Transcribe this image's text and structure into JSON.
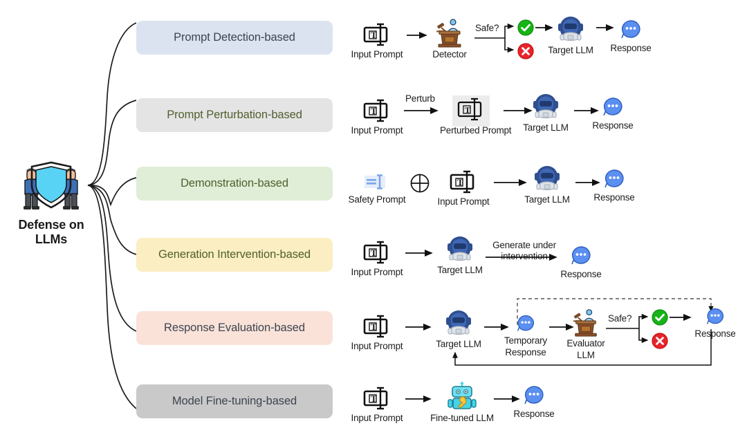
{
  "root": {
    "label_line1": "Defense on",
    "label_line2": "LLMs",
    "icon": "shield-with-guards-icon"
  },
  "palette": {
    "blue_box_bg": "#dce3f0",
    "blue_box_text": "#3d4450",
    "gray_box_bg": "#e4e4e4",
    "gray_box_text": "#4f5f2e",
    "green_box_bg": "#e0eed7",
    "green_box_text": "#4f5f2e",
    "yellow_box_bg": "#fbeec2",
    "yellow_box_text": "#4f5f2e",
    "peach_box_bg": "#fae2d8",
    "peach_box_text": "#3d4450",
    "darkgray_box_bg": "#c9c9c9",
    "darkgray_box_text": "#3d4450",
    "shield_cyan": "#58d2f5",
    "astronaut_navy": "#2f4f8f",
    "response_blue": "#5b8ff0",
    "check_green": "#17b317",
    "cross_red": "#e8242b",
    "robot_cyan": "#46d3e8",
    "podium_brown": "#8b4f2a",
    "arrow_black": "#111111"
  },
  "categories": [
    {
      "id": "prompt-detection",
      "label": "Prompt Detection-based"
    },
    {
      "id": "prompt-perturbation",
      "label": "Prompt Perturbation-based"
    },
    {
      "id": "demonstration",
      "label": "Demonstration-based"
    },
    {
      "id": "generation-intervention",
      "label": "Generation Intervention-based"
    },
    {
      "id": "response-evaluation",
      "label": "Response Evaluation-based"
    },
    {
      "id": "model-fine-tuning",
      "label": "Model Fine-tuning-based"
    }
  ],
  "rows": {
    "prompt_detection": {
      "input_prompt": "Input Prompt",
      "detector": "Detector",
      "safe_label": "Safe?",
      "target_llm": "Target LLM",
      "response": "Response",
      "check_icon": "green-check-icon",
      "cross_icon": "red-cross-icon"
    },
    "prompt_perturbation": {
      "input_prompt": "Input Prompt",
      "perturb_label": "Perturb",
      "perturbed_prompt": "Perturbed Prompt",
      "target_llm": "Target LLM",
      "response": "Response"
    },
    "demonstration": {
      "safety_prompt": "Safety Prompt",
      "plus_icon": "circle-plus-icon",
      "input_prompt": "Input Prompt",
      "target_llm": "Target LLM",
      "response": "Response"
    },
    "generation_intervention": {
      "input_prompt": "Input Prompt",
      "target_llm": "Target LLM",
      "edge_label_line1": "Generate under",
      "edge_label_line2": "intervention",
      "response": "Response"
    },
    "response_evaluation": {
      "input_prompt": "Input Prompt",
      "target_llm": "Target LLM",
      "temporary_response_line1": "Temporary",
      "temporary_response_line2": "Response",
      "evaluator_llm_line1": "Evaluator",
      "evaluator_llm_line2": "LLM",
      "safe_label": "Safe?",
      "response": "Response",
      "check_icon": "green-check-icon",
      "cross_icon": "red-cross-icon"
    },
    "model_fine_tuning": {
      "input_prompt": "Input Prompt",
      "fine_tuned_llm": "Fine-tuned LLM",
      "response": "Response"
    }
  }
}
